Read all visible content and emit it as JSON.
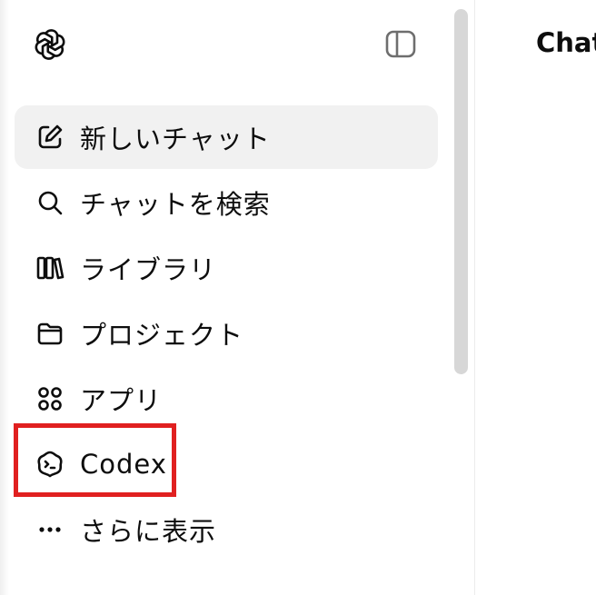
{
  "sidebar": {
    "items": [
      {
        "label": "新しいチャット",
        "icon": "compose-icon"
      },
      {
        "label": "チャットを検索",
        "icon": "search-icon"
      },
      {
        "label": "ライブラリ",
        "icon": "library-icon"
      },
      {
        "label": "プロジェクト",
        "icon": "folder-icon"
      },
      {
        "label": "アプリ",
        "icon": "apps-grid-icon"
      },
      {
        "label": "Codex",
        "icon": "codex-icon"
      },
      {
        "label": "さらに表示",
        "icon": "more-dots-icon"
      }
    ]
  },
  "main": {
    "title": "ChatGPT"
  },
  "colors": {
    "highlight": "#e02020",
    "active_bg": "#f1f1f1",
    "scrollbar": "#d7d7d7"
  }
}
